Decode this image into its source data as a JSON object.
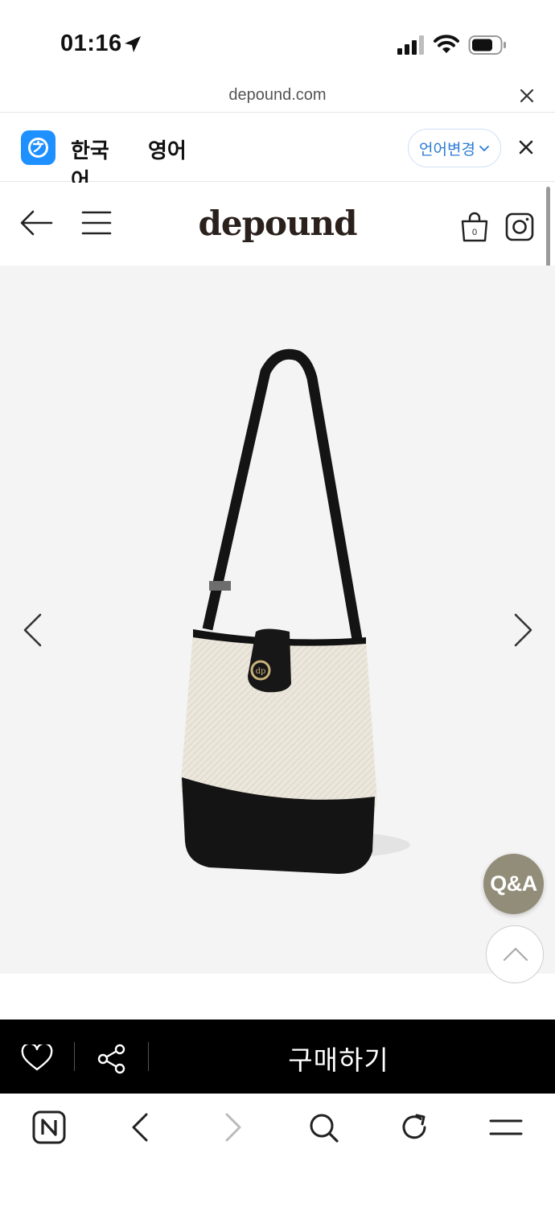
{
  "status_bar": {
    "time": "01:16"
  },
  "url_bar": {
    "url": "depound.com"
  },
  "translate_bar": {
    "tabs": [
      {
        "label": "한국어",
        "active": true
      },
      {
        "label": "영어",
        "active": false
      }
    ],
    "change_language_label": "언어변경"
  },
  "header": {
    "logo_text": "depound",
    "cart_count": "0"
  },
  "product": {
    "image": "black-and-ivory-bucket-bag-icon"
  },
  "floating": {
    "qa_label": "Q&A"
  },
  "buy_bar": {
    "buy_label": "구매하기"
  },
  "colors": {
    "accent_blue": "#2b7bd6",
    "qa_bg": "#928d78",
    "buy_bar_bg": "#000000"
  }
}
